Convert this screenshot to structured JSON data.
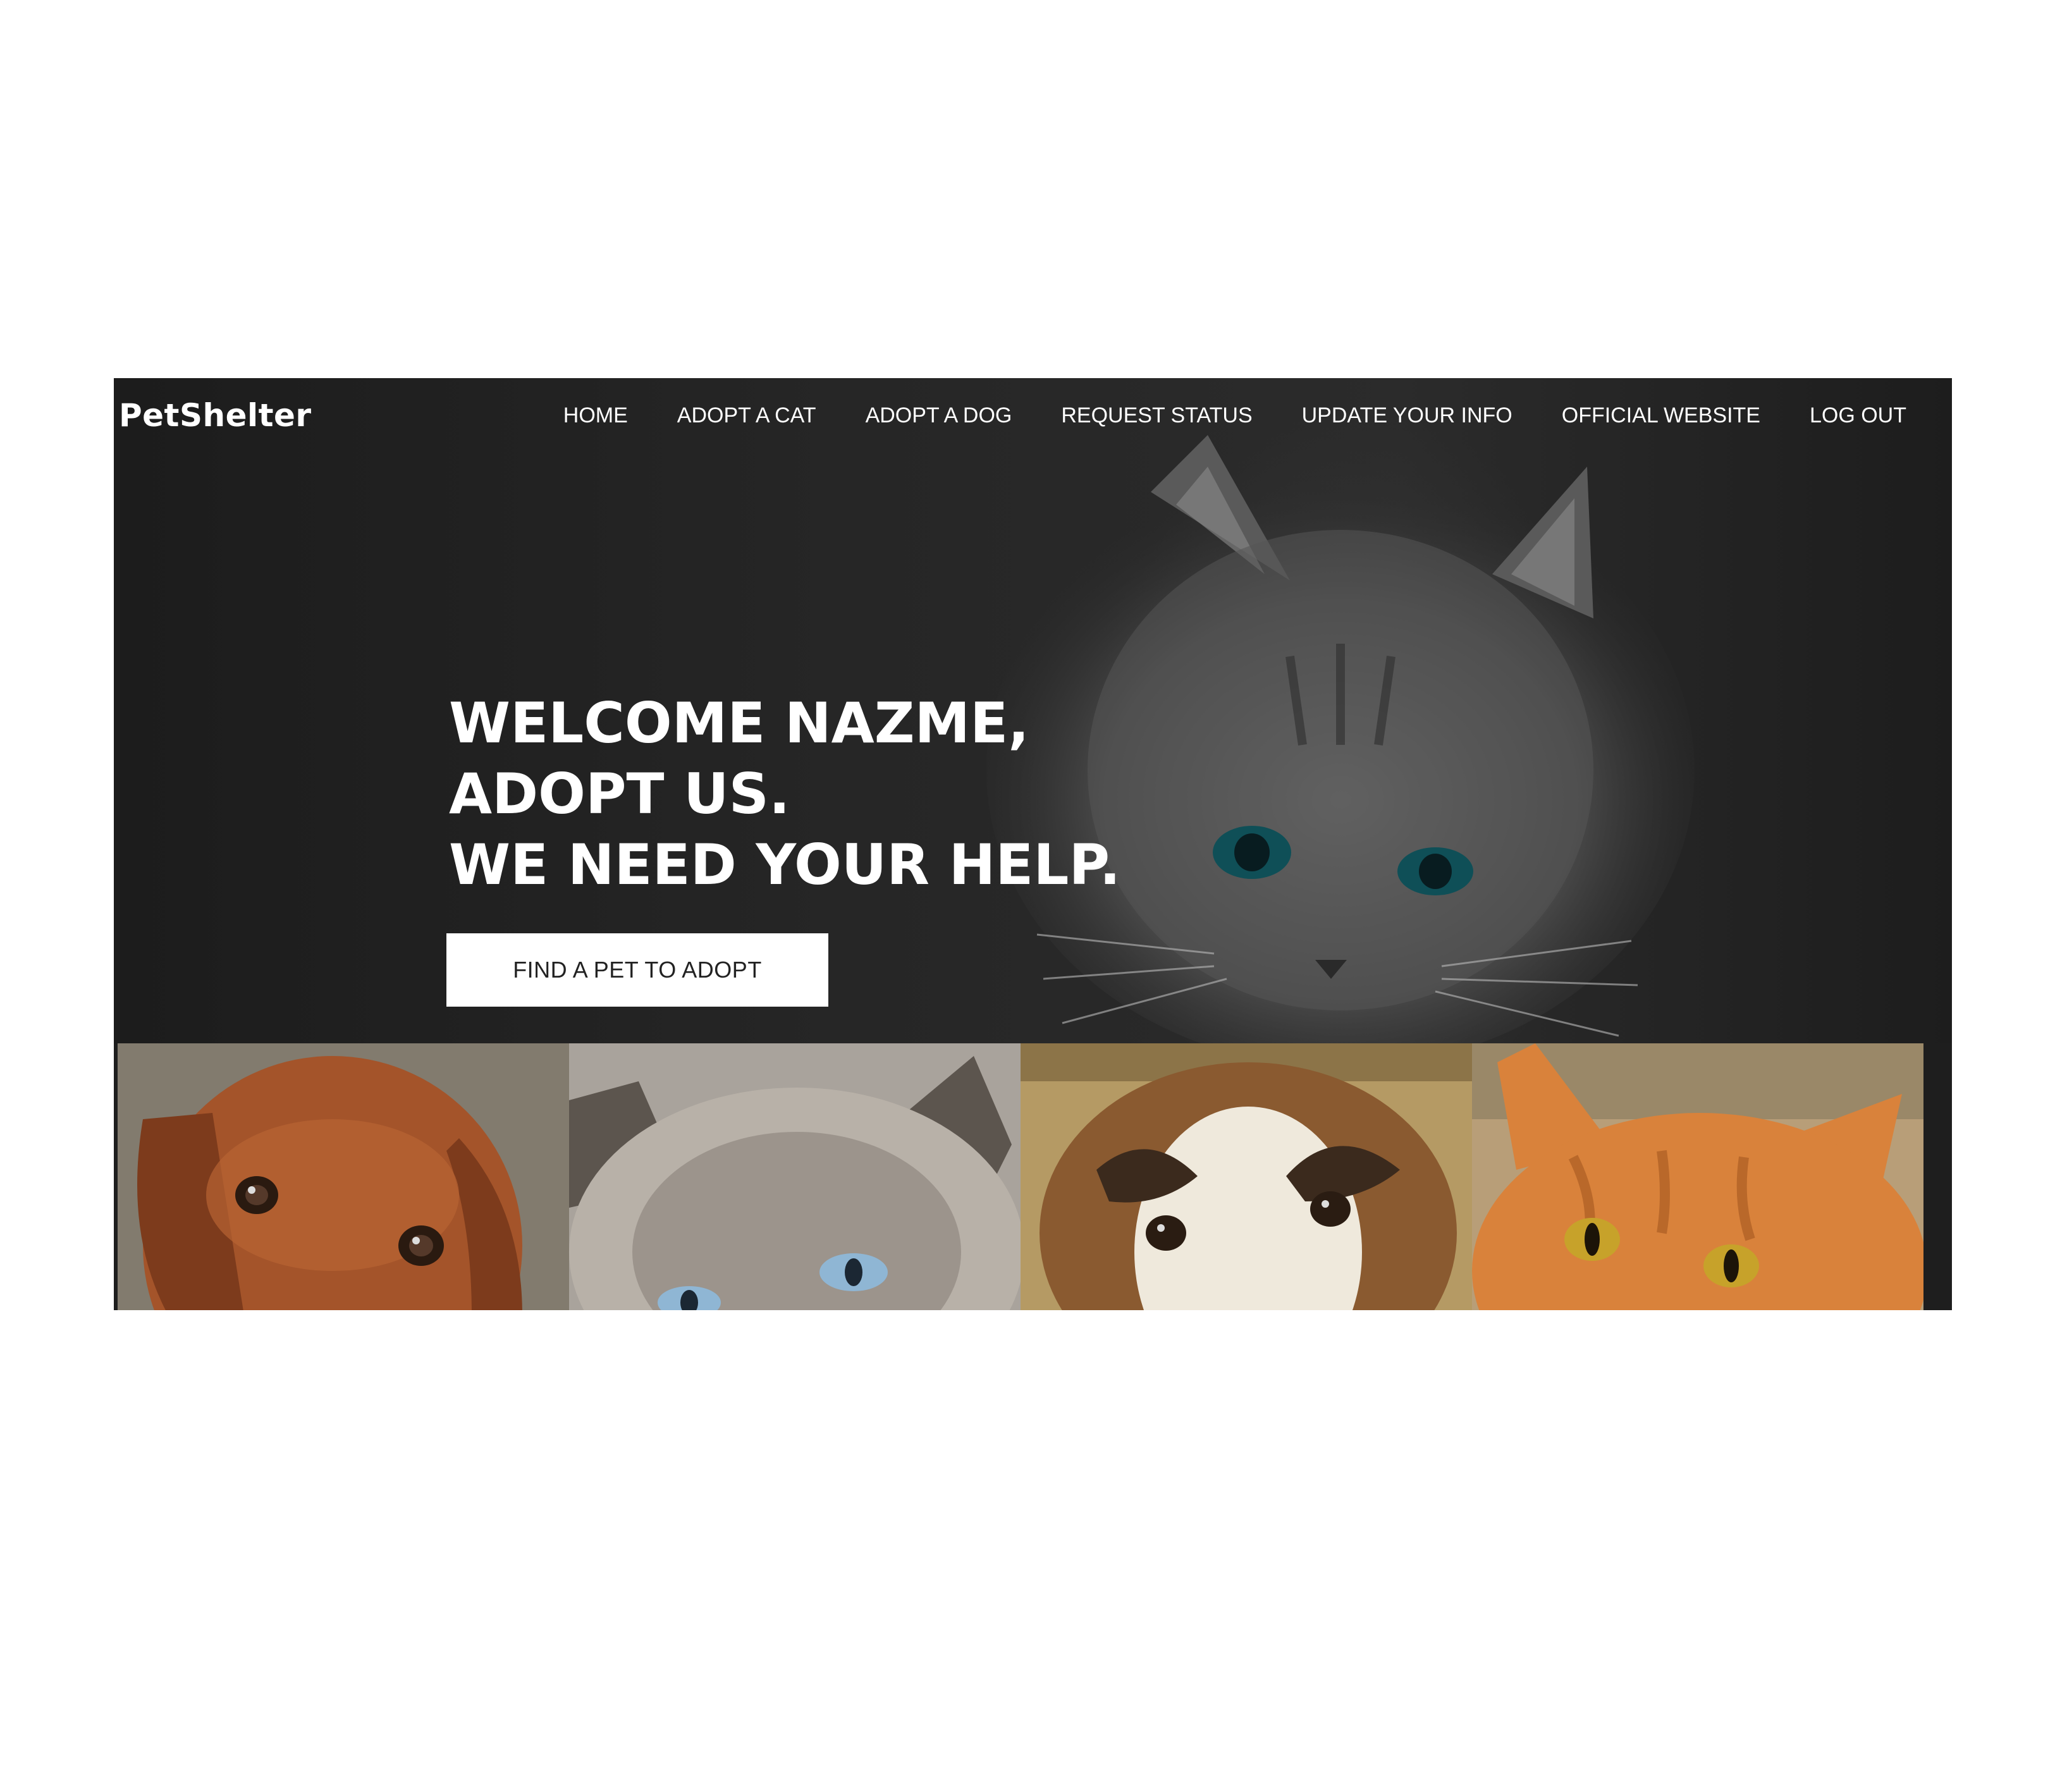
{
  "brand": {
    "name": "PetShelter"
  },
  "nav": {
    "items": [
      {
        "label": "HOME"
      },
      {
        "label": "ADOPT A CAT"
      },
      {
        "label": "ADOPT A DOG"
      },
      {
        "label": "REQUEST STATUS"
      },
      {
        "label": "UPDATE YOUR INFO"
      },
      {
        "label": "OFFICIAL WEBSITE"
      },
      {
        "label": "LOG OUT"
      }
    ]
  },
  "hero": {
    "lines": [
      "WELCOME NAZME,",
      "ADOPT US.",
      "WE NEED YOUR HELP."
    ],
    "cta_label": "FIND A PET TO ADOPT",
    "background_image": "grey-kitten-icon"
  },
  "gallery": {
    "tiles": [
      {
        "icon": "dachshund-face-icon"
      },
      {
        "icon": "grey-cat-face-icon"
      },
      {
        "icon": "fluffy-puppy-face-icon"
      },
      {
        "icon": "orange-cat-face-icon"
      }
    ]
  },
  "colors": {
    "hero_bg": "#1e1e1e",
    "text_on_dark": "#ffffff",
    "button_bg": "#ffffff",
    "button_text": "#222222"
  }
}
